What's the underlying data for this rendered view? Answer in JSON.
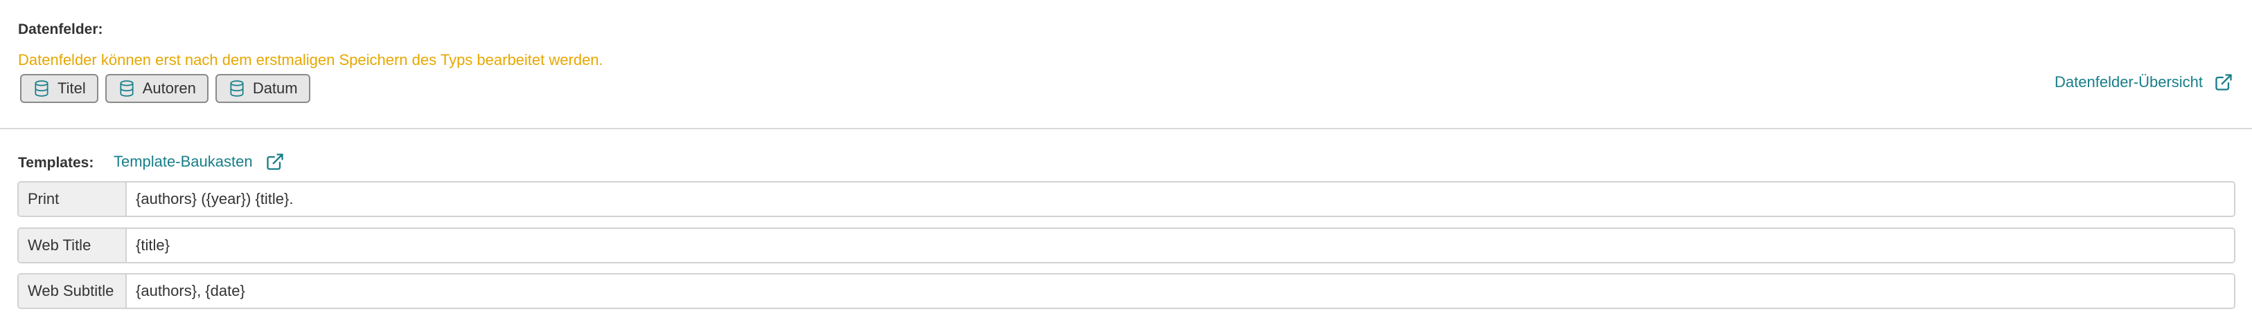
{
  "data_fields": {
    "heading": "Datenfelder:",
    "warning": "Datenfelder können erst nach dem erstmaligen Speichern des Typs bearbeitet werden.",
    "fields": [
      {
        "label": "Titel",
        "icon": "database-icon"
      },
      {
        "label": "Autoren",
        "icon": "database-icon"
      },
      {
        "label": "Datum",
        "icon": "database-icon"
      }
    ],
    "overview_link": "Datenfelder-Übersicht",
    "overview_icon": "external-link-icon"
  },
  "templates": {
    "heading": "Templates:",
    "baukasten_link": "Template-Baukasten",
    "baukasten_icon": "external-link-icon",
    "rows": [
      {
        "label": "Print",
        "value": "{authors} ({year}) {title}."
      },
      {
        "label": "Web Title",
        "value": "{title}"
      },
      {
        "label": "Web Subtitle",
        "value": "{authors}, {date}"
      }
    ]
  },
  "colors": {
    "warning": "#e6a700",
    "link": "#177e89",
    "chip_icon": "#177e89"
  }
}
